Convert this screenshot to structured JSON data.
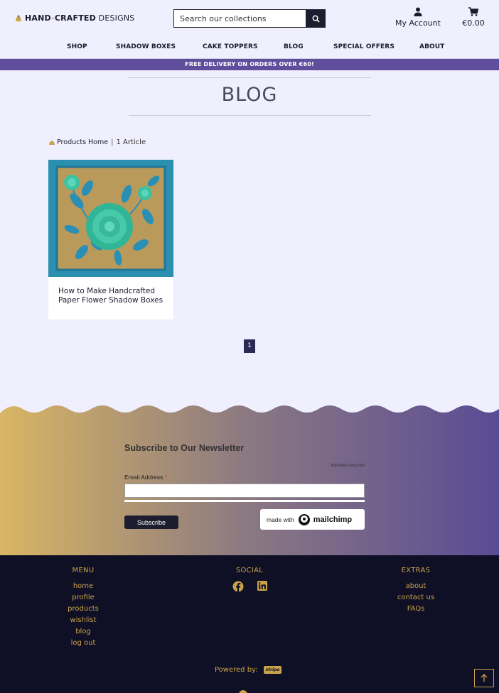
{
  "header": {
    "logo": {
      "part1": "HAND",
      "dash": "-",
      "part2": "CRAFTED",
      "part3": " DESIGNS"
    },
    "search_placeholder": "Search our collections",
    "account_label": "My Account",
    "cart_total": "€0.00"
  },
  "nav": {
    "items": [
      {
        "label": "SHOP"
      },
      {
        "label": "SHADOW BOXES"
      },
      {
        "label": "CAKE TOPPERS"
      },
      {
        "label": "BLOG"
      },
      {
        "label": "SPECIAL OFFERS"
      },
      {
        "label": "ABOUT"
      }
    ]
  },
  "promo": {
    "text": "FREE DELIVERY ON ORDERS OVER €60!"
  },
  "page": {
    "title": "BLOG",
    "breadcrumb": {
      "home_label": "Products Home",
      "separator": "|",
      "count": "1 Article"
    }
  },
  "articles": [
    {
      "title": "How to Make Handcrafted Paper Flower Shadow Boxes"
    }
  ],
  "pagination": {
    "current": "1"
  },
  "newsletter": {
    "title": "Subscribe to Our Newsletter",
    "required_star": "*",
    "required_note": " indicates required",
    "email_label": "Email Address ",
    "email_value": "",
    "subscribe_label": "Subscribe",
    "badge_made_with": "made with",
    "badge_brand": "mailchimp"
  },
  "footer": {
    "menu": {
      "heading": "MENU",
      "links": [
        "home",
        "profile",
        "products",
        "wishlist",
        "blog",
        "log out"
      ]
    },
    "social": {
      "heading": "SOCIAL",
      "icons": [
        "facebook-icon",
        "linkedin-icon"
      ]
    },
    "extras": {
      "heading": "EXTRAS",
      "links": [
        "about",
        "contact us",
        "FAQs"
      ]
    },
    "powered_by": "Powered by:",
    "payment_logo": "stripe"
  },
  "colors": {
    "accent_gold": "#c9a34a",
    "promo_purple": "#5f4e9b",
    "footer_bg": "#0f0f25",
    "page_bg": "#f0effd"
  }
}
